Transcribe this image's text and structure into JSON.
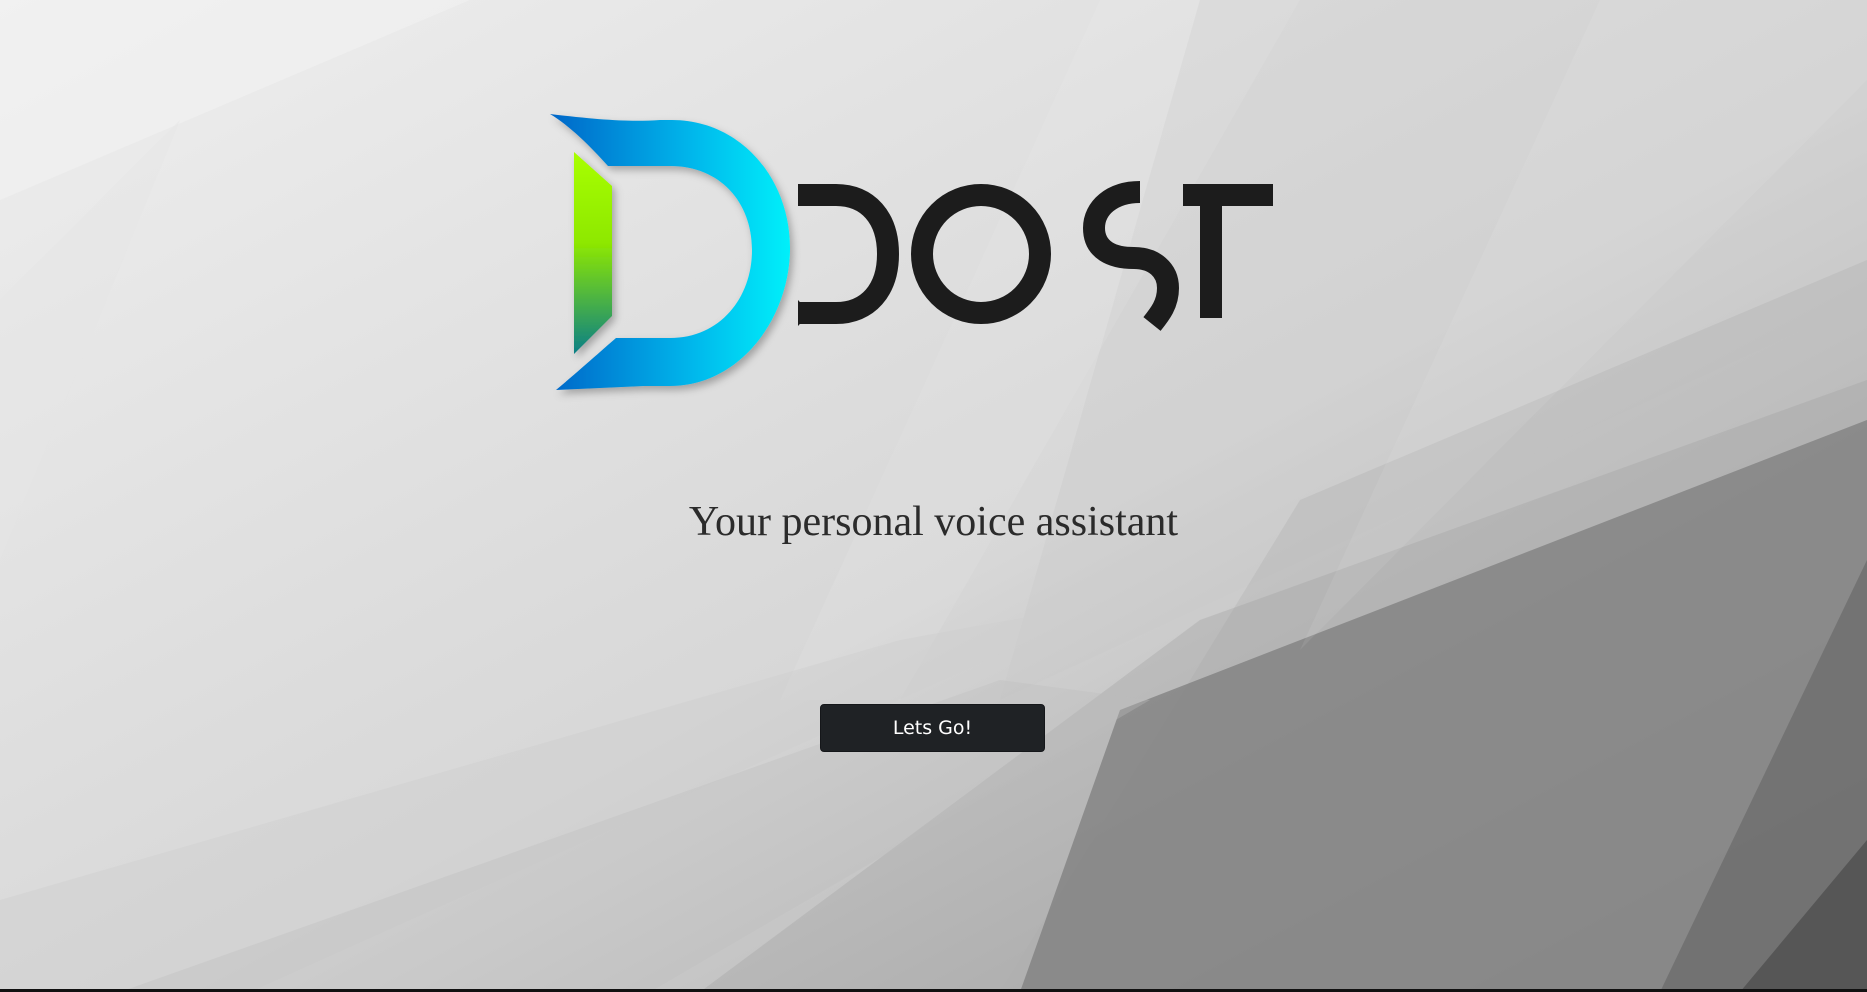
{
  "app": {
    "logo_text": "Ddost",
    "tagline": "Your personal voice assistant",
    "cta_label": "Lets Go!"
  },
  "colors": {
    "background_light": "#ececec",
    "background_dark": "#5e5e5e",
    "logo_blue": "#0078d4",
    "logo_cyan": "#00e8f8",
    "logo_green": "#a6ff00",
    "logo_dark": "#1c1c1c",
    "button_bg": "#1f2225",
    "button_text": "#ffffff"
  },
  "icons": {
    "logo": "ddost-logo"
  }
}
